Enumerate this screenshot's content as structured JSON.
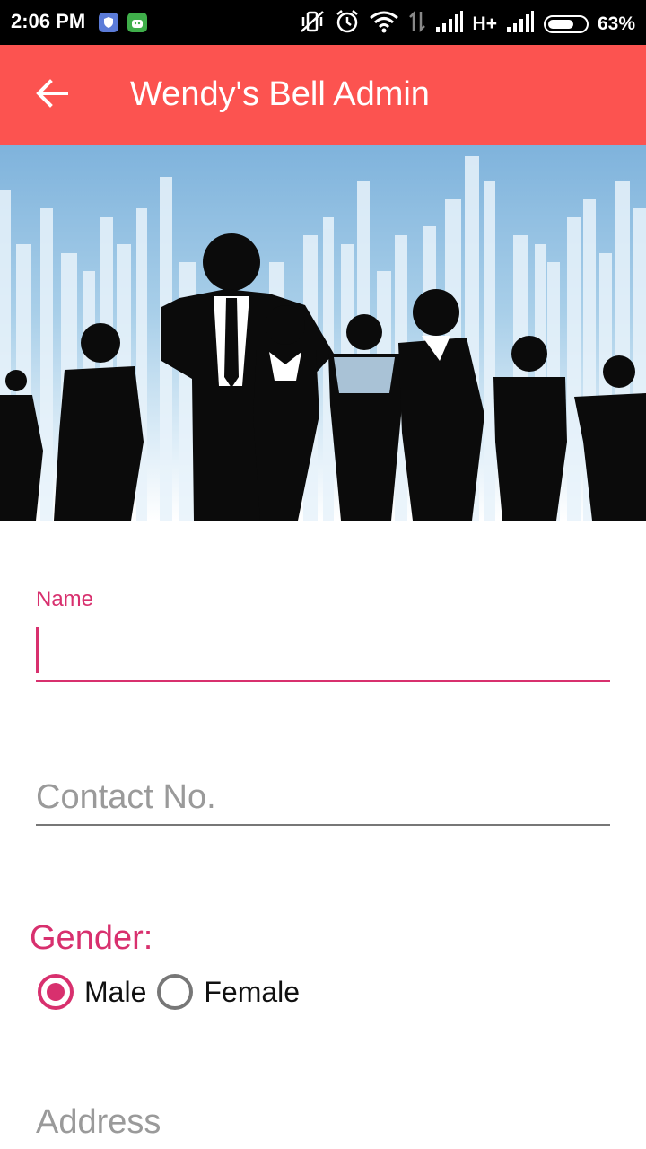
{
  "status_bar": {
    "time": "2:06 PM",
    "network": "H+",
    "battery": "63%",
    "battery_level": 0.63,
    "icons": [
      "shield-app-icon",
      "android-app-icon",
      "vibrate-off-icon",
      "alarm-icon",
      "wifi-icon",
      "data-arrows-icon",
      "signal-icon",
      "signal-icon-2",
      "battery-icon"
    ]
  },
  "app_bar": {
    "title": "Wendy's Bell Admin",
    "back_icon": "arrow-left-icon",
    "color": "#fc5350"
  },
  "banner": {
    "description_icon": "business-people-silhouette-image"
  },
  "form": {
    "name": {
      "label": "Name",
      "value": ""
    },
    "contact": {
      "placeholder": "Contact No.",
      "value": ""
    },
    "gender": {
      "label": "Gender:",
      "options": [
        {
          "label": "Male",
          "selected": true
        },
        {
          "label": "Female",
          "selected": false
        }
      ]
    },
    "address": {
      "placeholder": "Address",
      "value": ""
    }
  },
  "colors": {
    "accent": "#d8306e",
    "app_bar": "#fc5350"
  }
}
